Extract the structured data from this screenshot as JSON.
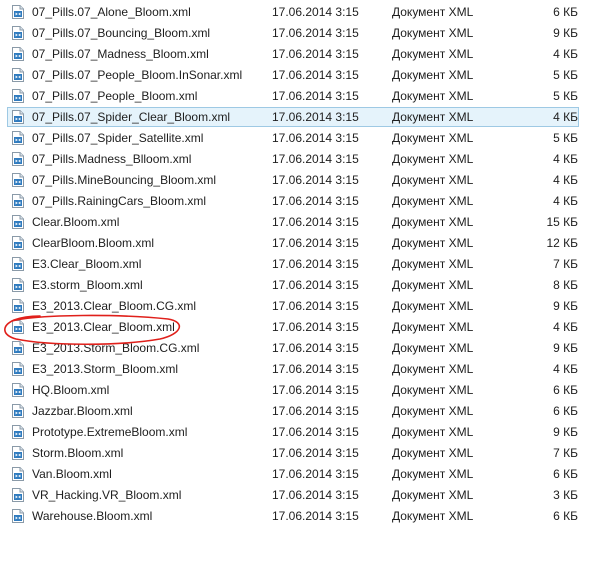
{
  "annotation_color": "#e0201b",
  "files": [
    {
      "name": "07_Pills.07_Alone_Bloom.xml",
      "date": "17.06.2014 3:15",
      "type": "Документ XML",
      "size": "6 КБ"
    },
    {
      "name": "07_Pills.07_Bouncing_Bloom.xml",
      "date": "17.06.2014 3:15",
      "type": "Документ XML",
      "size": "9 КБ"
    },
    {
      "name": "07_Pills.07_Madness_Bloom.xml",
      "date": "17.06.2014 3:15",
      "type": "Документ XML",
      "size": "4 КБ"
    },
    {
      "name": "07_Pills.07_People_Bloom.InSonar.xml",
      "date": "17.06.2014 3:15",
      "type": "Документ XML",
      "size": "5 КБ"
    },
    {
      "name": "07_Pills.07_People_Bloom.xml",
      "date": "17.06.2014 3:15",
      "type": "Документ XML",
      "size": "5 КБ"
    },
    {
      "name": "07_Pills.07_Spider_Clear_Bloom.xml",
      "date": "17.06.2014 3:15",
      "type": "Документ XML",
      "size": "4 КБ",
      "selected": true
    },
    {
      "name": "07_Pills.07_Spider_Satellite.xml",
      "date": "17.06.2014 3:15",
      "type": "Документ XML",
      "size": "5 КБ"
    },
    {
      "name": "07_Pills.Madness_Blloom.xml",
      "date": "17.06.2014 3:15",
      "type": "Документ XML",
      "size": "4 КБ"
    },
    {
      "name": "07_Pills.MineBouncing_Bloom.xml",
      "date": "17.06.2014 3:15",
      "type": "Документ XML",
      "size": "4 КБ"
    },
    {
      "name": "07_Pills.RainingCars_Bloom.xml",
      "date": "17.06.2014 3:15",
      "type": "Документ XML",
      "size": "4 КБ"
    },
    {
      "name": "Clear.Bloom.xml",
      "date": "17.06.2014 3:15",
      "type": "Документ XML",
      "size": "15 КБ"
    },
    {
      "name": "ClearBloom.Bloom.xml",
      "date": "17.06.2014 3:15",
      "type": "Документ XML",
      "size": "12 КБ"
    },
    {
      "name": "E3.Clear_Bloom.xml",
      "date": "17.06.2014 3:15",
      "type": "Документ XML",
      "size": "7 КБ"
    },
    {
      "name": "E3.storm_Bloom.xml",
      "date": "17.06.2014 3:15",
      "type": "Документ XML",
      "size": "8 КБ"
    },
    {
      "name": "E3_2013.Clear_Bloom.CG.xml",
      "date": "17.06.2014 3:15",
      "type": "Документ XML",
      "size": "9 КБ"
    },
    {
      "name": "E3_2013.Clear_Bloom.xml",
      "date": "17.06.2014 3:15",
      "type": "Документ XML",
      "size": "4 КБ",
      "circled": true
    },
    {
      "name": "E3_2013.Storm_Bloom.CG.xml",
      "date": "17.06.2014 3:15",
      "type": "Документ XML",
      "size": "9 КБ"
    },
    {
      "name": "E3_2013.Storm_Bloom.xml",
      "date": "17.06.2014 3:15",
      "type": "Документ XML",
      "size": "4 КБ"
    },
    {
      "name": "HQ.Bloom.xml",
      "date": "17.06.2014 3:15",
      "type": "Документ XML",
      "size": "6 КБ"
    },
    {
      "name": "Jazzbar.Bloom.xml",
      "date": "17.06.2014 3:15",
      "type": "Документ XML",
      "size": "6 КБ"
    },
    {
      "name": "Prototype.ExtremeBloom.xml",
      "date": "17.06.2014 3:15",
      "type": "Документ XML",
      "size": "9 КБ"
    },
    {
      "name": "Storm.Bloom.xml",
      "date": "17.06.2014 3:15",
      "type": "Документ XML",
      "size": "7 КБ"
    },
    {
      "name": "Van.Bloom.xml",
      "date": "17.06.2014 3:15",
      "type": "Документ XML",
      "size": "6 КБ"
    },
    {
      "name": "VR_Hacking.VR_Bloom.xml",
      "date": "17.06.2014 3:15",
      "type": "Документ XML",
      "size": "3 КБ"
    },
    {
      "name": "Warehouse.Bloom.xml",
      "date": "17.06.2014 3:15",
      "type": "Документ XML",
      "size": "6 КБ"
    }
  ]
}
